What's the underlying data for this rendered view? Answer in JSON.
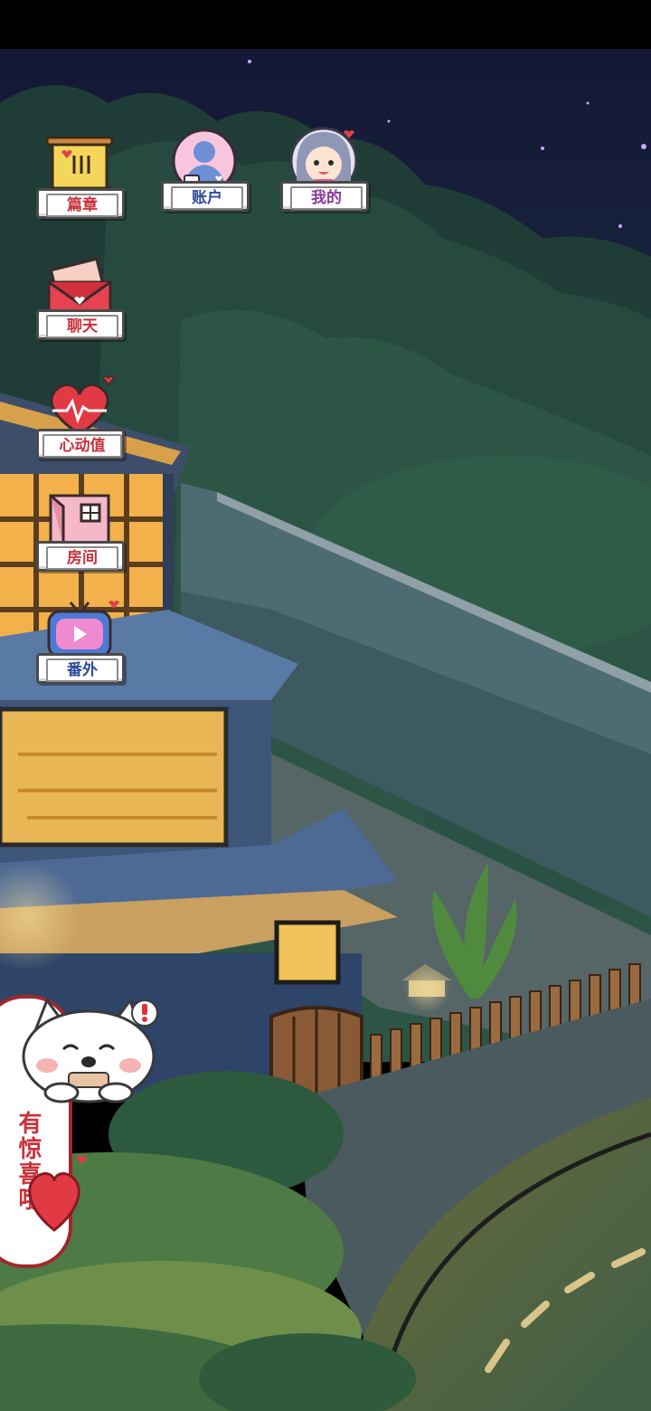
{
  "menu": {
    "chapters_label": "篇章",
    "account_label": "账户",
    "mine_label": "我的",
    "chat_label": "聊天",
    "affection_label": "心动值",
    "room_label": "房间",
    "extra_label": "番外"
  },
  "banner": {
    "text": "有惊喜哦"
  },
  "colors": {
    "label_red": "#c8323a",
    "label_blue": "#2f4a9a",
    "label_purple": "#8a3a9a",
    "night_sky": "#141a33",
    "foliage_dark": "#234c3e",
    "window_glow": "#f2b14a"
  }
}
